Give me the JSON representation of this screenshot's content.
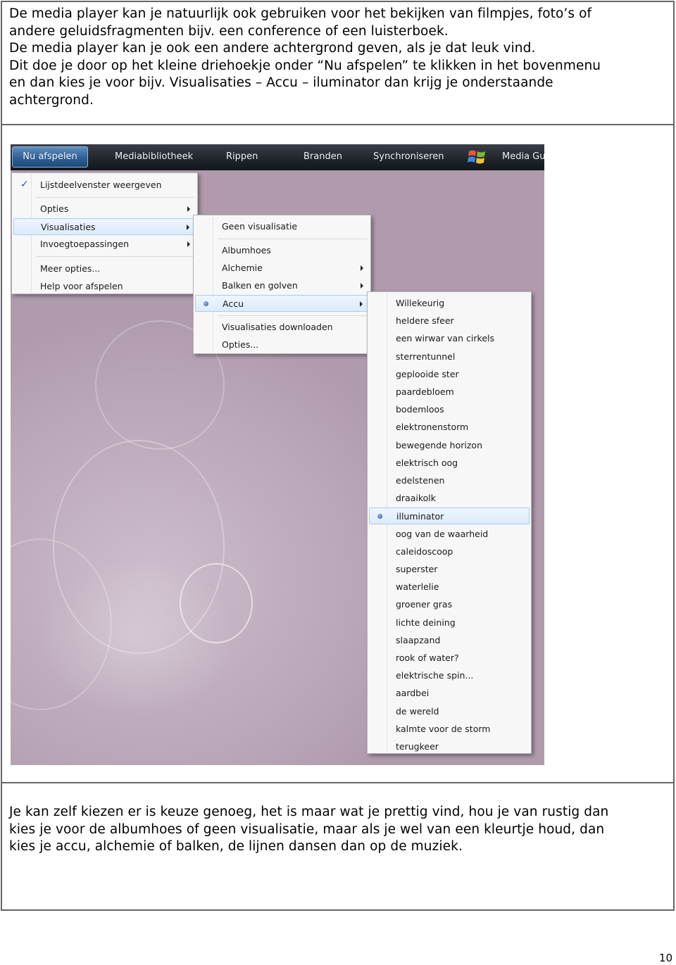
{
  "intro": {
    "lines": [
      "De media player kan je natuurlijk ook gebruiken voor het bekijken van filmpjes, foto’s of",
      "andere geluidsfragmenten bijv. een conference of een luisterboek.",
      "De media player kan je ook een andere achtergrond geven, als je dat leuk vind.",
      "Dit doe je door op het kleine driehoekje onder “Nu afspelen” te klikken in het bovenmenu",
      "en dan kies je voor bijv. Visualisaties – Accu – iluminator dan krijg je onderstaande",
      "achtergrond."
    ]
  },
  "menubar": {
    "items": [
      "Nu afspelen",
      "Mediabibliotheek",
      "Rippen",
      "Branden",
      "Synchroniseren",
      "Media Gu"
    ]
  },
  "menu_main": {
    "items": [
      {
        "label": "Lijstdeelvenster weergeven",
        "checked": true
      },
      {
        "label": "Opties"
      },
      {
        "label": "Visualisaties"
      },
      {
        "label": "Invoegtoepassingen"
      },
      {
        "label": "Meer opties..."
      },
      {
        "label": "Help voor afspelen"
      }
    ]
  },
  "menu_visualizations": {
    "items": [
      {
        "label": "Geen visualisatie"
      },
      {
        "label": "Albumhoes"
      },
      {
        "label": "Alchemie"
      },
      {
        "label": "Balken en golven"
      },
      {
        "label": "Accu",
        "selected": true
      },
      {
        "label": "Visualisaties downloaden"
      },
      {
        "label": "Opties..."
      }
    ]
  },
  "menu_accu": {
    "items": [
      "Willekeurig",
      "heldere sfeer",
      "een wirwar van cirkels",
      "sterrentunnel",
      "geplooide ster",
      "paardebloem",
      "bodemloos",
      "elektronenstorm",
      "bewegende horizon",
      "elektrisch oog",
      "edelstenen",
      "draaikolk",
      "illuminator",
      "oog van de waarheid",
      "caleidoscoop",
      "superster",
      "waterlelie",
      "groener gras",
      "lichte deining",
      "slaapzand",
      "rook of water?",
      "elektrische spin...",
      "aardbei",
      "de wereld",
      "kalmte voor de storm",
      "terugkeer"
    ],
    "selected": "illuminator"
  },
  "closing": {
    "lines": [
      "Je kan zelf kiezen er is keuze genoeg, het is maar wat je prettig vind, hou je van rustig dan",
      "kies je voor de albumhoes of geen visualisatie, maar als je wel van een kleurtje houd, dan",
      "kies je accu, alchemie of balken, de lijnen dansen dan op de muziek."
    ]
  },
  "page_number": "10",
  "colors": {
    "menubar": "#1f232a",
    "active_tab": "#2f5f94",
    "visualization_bg": "#bda9bb",
    "menu_bg": "#f7f7f7",
    "highlight": "#dcebfc"
  }
}
